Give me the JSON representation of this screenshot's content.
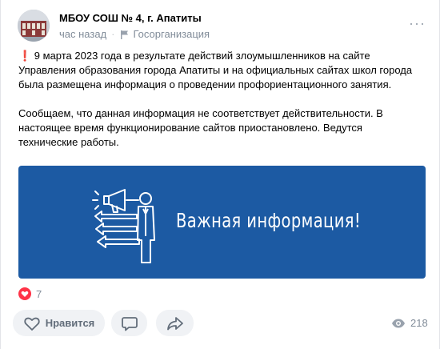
{
  "post": {
    "author": "МБОУ СОШ № 4, г. Апатиты",
    "time": "час назад",
    "category": "Госорганизация",
    "paragraph1_mark": "❗",
    "paragraph1": " 9 марта 2023 года в результате действий злоумышленников на сайте Управления образования города Апатиты и на официальных сайтах школ города была размещена информация о проведении профориентационного занятия.",
    "paragraph2": "Сообщаем, что данная информация не соответствует действительности. В настоящее время функционирование сайтов приостановлено. Ведутся технические работы.",
    "banner_text": "Важная информация!"
  },
  "reactions": {
    "likes_count": "7"
  },
  "actions": {
    "like_label": "Нравится"
  },
  "views": {
    "count": "218"
  },
  "colors": {
    "banner": "#1c5aa3",
    "heart": "#e64646",
    "muted": "#818c99",
    "button_bg": "#f0f2f5"
  },
  "icons": [
    "more-icon",
    "flag-icon",
    "heart-icon",
    "like-icon",
    "comment-icon",
    "share-icon",
    "eye-icon",
    "megaphone-icon",
    "arrow-icon"
  ]
}
